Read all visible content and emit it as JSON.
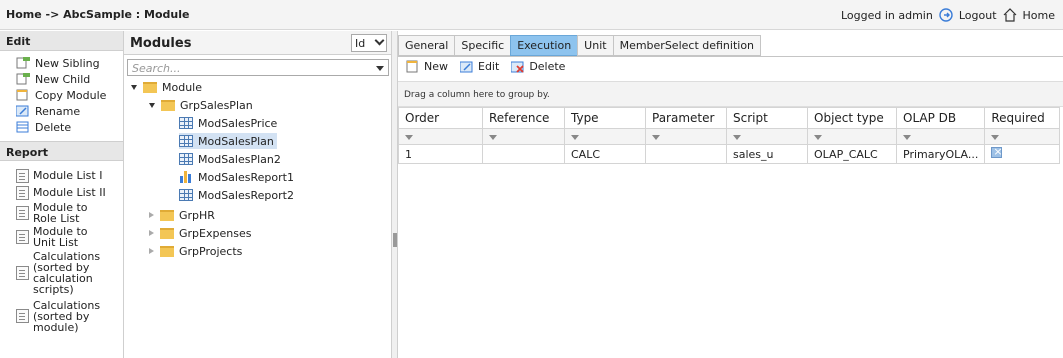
{
  "header": {
    "breadcrumb": "Home -> AbcSample : Module",
    "logged_in": "Logged in admin",
    "logout": "Logout",
    "home": "Home"
  },
  "left": {
    "edit_title": "Edit",
    "edit_items": [
      "New Sibling",
      "New Child",
      "Copy Module",
      "Rename",
      "Delete"
    ],
    "report_title": "Report",
    "report_items": [
      "Module List I",
      "Module List II",
      "Module to Role List",
      "Module to Unit List",
      "Calculations (sorted by calculation scripts)",
      "Calculations (sorted by module)"
    ]
  },
  "modules": {
    "title": "Modules",
    "sort_value": "Id",
    "search_placeholder": "Search...",
    "tree": {
      "root": "Module",
      "group_open": "GrpSalesPlan",
      "children": [
        "ModSalesPrice",
        "ModSalesPlan",
        "ModSalesPlan2",
        "ModSalesReport1",
        "ModSalesReport2"
      ],
      "selected": "ModSalesPlan",
      "groups_closed": [
        "GrpHR",
        "GrpExpenses",
        "GrpProjects"
      ]
    }
  },
  "tabs": [
    "General",
    "Specific",
    "Execution",
    "Unit",
    "MemberSelect definition"
  ],
  "active_tab": "Execution",
  "toolbar": {
    "new": "New",
    "edit": "Edit",
    "delete": "Delete"
  },
  "group_hint": "Drag a column here to group by.",
  "grid": {
    "columns": [
      "Order",
      "Reference",
      "Type",
      "Parameter",
      "Script",
      "Object type",
      "OLAP DB",
      "Required"
    ],
    "rows": [
      {
        "order": "1",
        "reference": "",
        "type": "CALC",
        "parameter": "",
        "script": "sales_u",
        "object_type": "OLAP_CALC",
        "olap_db": "PrimaryOLA...",
        "required": true
      }
    ]
  }
}
